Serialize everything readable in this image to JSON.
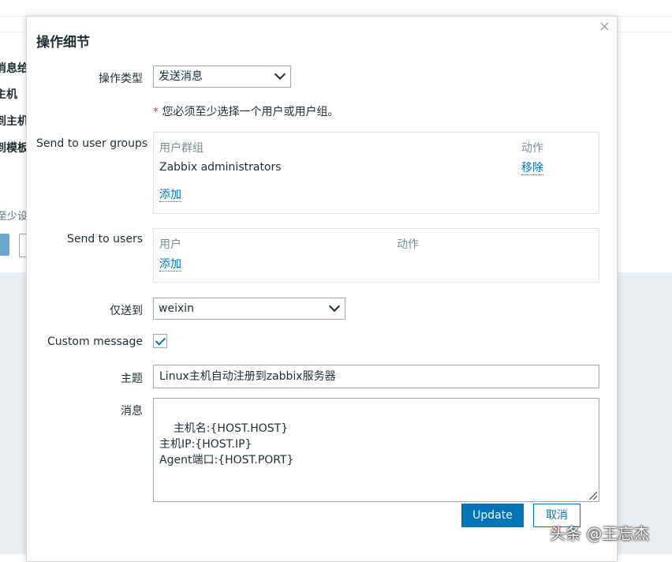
{
  "background": {
    "labels": [
      "消息给",
      "主机",
      "到主机",
      "到模板"
    ],
    "hint": "至少设"
  },
  "modal": {
    "title": "操作细节",
    "close_glyph": "×",
    "operation_type": {
      "label": "操作类型",
      "value": "发送消息"
    },
    "required_note": {
      "star": "*",
      "text": " 您必须至少选择一个用户或用户组。"
    },
    "user_groups": {
      "label": "Send to user groups",
      "col_group": "用户群组",
      "col_action": "动作",
      "rows": [
        {
          "name": "Zabbix administrators",
          "action": "移除"
        }
      ],
      "add": "添加"
    },
    "users": {
      "label": "Send to users",
      "col_user": "用户",
      "col_action": "动作",
      "add": "添加"
    },
    "send_only_to": {
      "label": "仅送到",
      "value": "weixin"
    },
    "custom_message": {
      "label": "Custom message",
      "checked": true
    },
    "subject": {
      "label": "主题",
      "value": "Linux主机自动注册到zabbix服务器"
    },
    "message": {
      "label": "消息",
      "value": "主机名:{HOST.HOST}\n主机IP:{HOST.IP}\nAgent端口:{HOST.PORT}"
    },
    "buttons": {
      "update": "Update",
      "cancel": "取消"
    }
  },
  "watermark": "头条 @王忘杰",
  "colors": {
    "accent": "#0275b8",
    "required": "#e33734",
    "border": "#9da7ad"
  }
}
